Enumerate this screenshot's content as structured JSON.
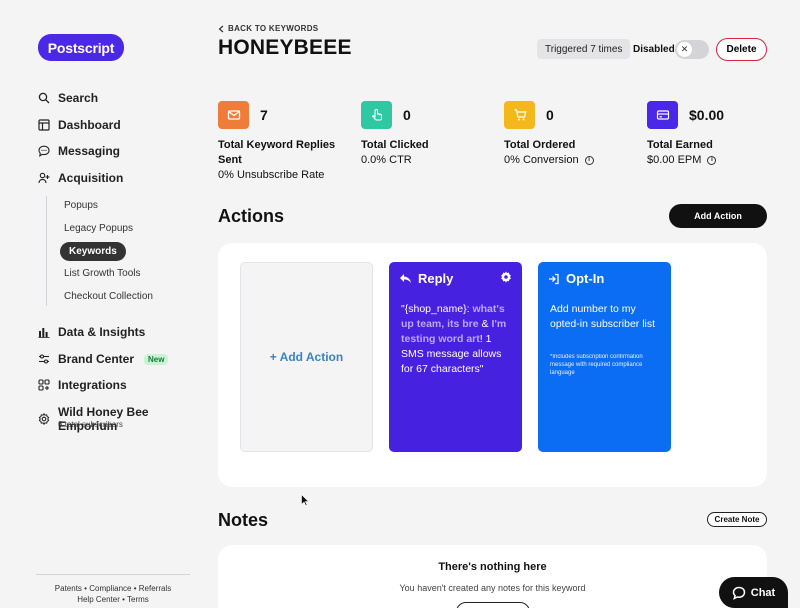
{
  "brand": {
    "logo_text": "Postscript",
    "accent": "#4a28e6"
  },
  "sidebar": {
    "nav": [
      {
        "label": "Search",
        "icon": "search-icon"
      },
      {
        "label": "Dashboard",
        "icon": "layout-icon"
      },
      {
        "label": "Messaging",
        "icon": "chat-bubble-icon"
      },
      {
        "label": "Acquisition",
        "icon": "user-plus-icon"
      }
    ],
    "acquisition_sub": [
      {
        "label": "Popups"
      },
      {
        "label": "Legacy Popups"
      },
      {
        "label": "Keywords"
      },
      {
        "label": "List Growth Tools"
      },
      {
        "label": "Checkout Collection"
      }
    ],
    "nav2": [
      {
        "label": "Data & Insights",
        "icon": "bar-chart-icon"
      },
      {
        "label": "Brand Center",
        "icon": "sliders-icon",
        "badge": "New"
      },
      {
        "label": "Integrations",
        "icon": "grid-plus-icon"
      },
      {
        "label": "Wild Honey Bee Emporium",
        "icon": "gear-icon",
        "subtext": "6 total subscribers"
      }
    ],
    "footer": {
      "patents": "Patents",
      "compliance": "Compliance",
      "referrals": "Referrals",
      "help": "Help Center",
      "terms": "Terms",
      "sep": "•"
    }
  },
  "header": {
    "back_label": "BACK TO KEYWORDS",
    "title": "HONEYBEEE",
    "triggered": "Triggered 7 times",
    "toggle_label": "Disabled",
    "toggle_symbol": "✕",
    "delete_label": "Delete"
  },
  "stats": [
    {
      "value": "7",
      "label": "Total Keyword Replies Sent",
      "sub": "0% Unsubscribe Rate",
      "color": "#f07c3a",
      "icon": "mail-icon",
      "info": false
    },
    {
      "value": "0",
      "label": "Total Clicked",
      "sub": "0.0% CTR",
      "color": "#2ec9a3",
      "icon": "pointer-icon",
      "info": false
    },
    {
      "value": "0",
      "label": "Total Ordered",
      "sub": "0%  Conversion",
      "color": "#f5b81c",
      "icon": "cart-icon",
      "info": true
    },
    {
      "value": "$0.00",
      "label": "Total Earned",
      "sub": "$0.00  EPM",
      "color": "#4a28e6",
      "icon": "wallet-icon",
      "info": true
    }
  ],
  "actions": {
    "title": "Actions",
    "add_button": "Add Action",
    "add_card": "+ Add Action",
    "reply_card": {
      "title": "Reply",
      "text_open": "\"{shop_name}: ",
      "text_art1": "what's up team, its bre",
      "text_amp": " & ",
      "text_art2": "I'm testing word art",
      "text_close": "! 1 SMS message allows for 67 characters\""
    },
    "optin_card": {
      "title": "Opt-In",
      "text": "Add number to my opted-in subscriber list",
      "note": "*Includes subscription confirmation message with required compliance language"
    }
  },
  "notes": {
    "title": "Notes",
    "create_button": "Create Note",
    "empty_title": "There's nothing here",
    "empty_sub": "You haven't created any notes for this keyword"
  },
  "chat": {
    "label": "Chat"
  }
}
